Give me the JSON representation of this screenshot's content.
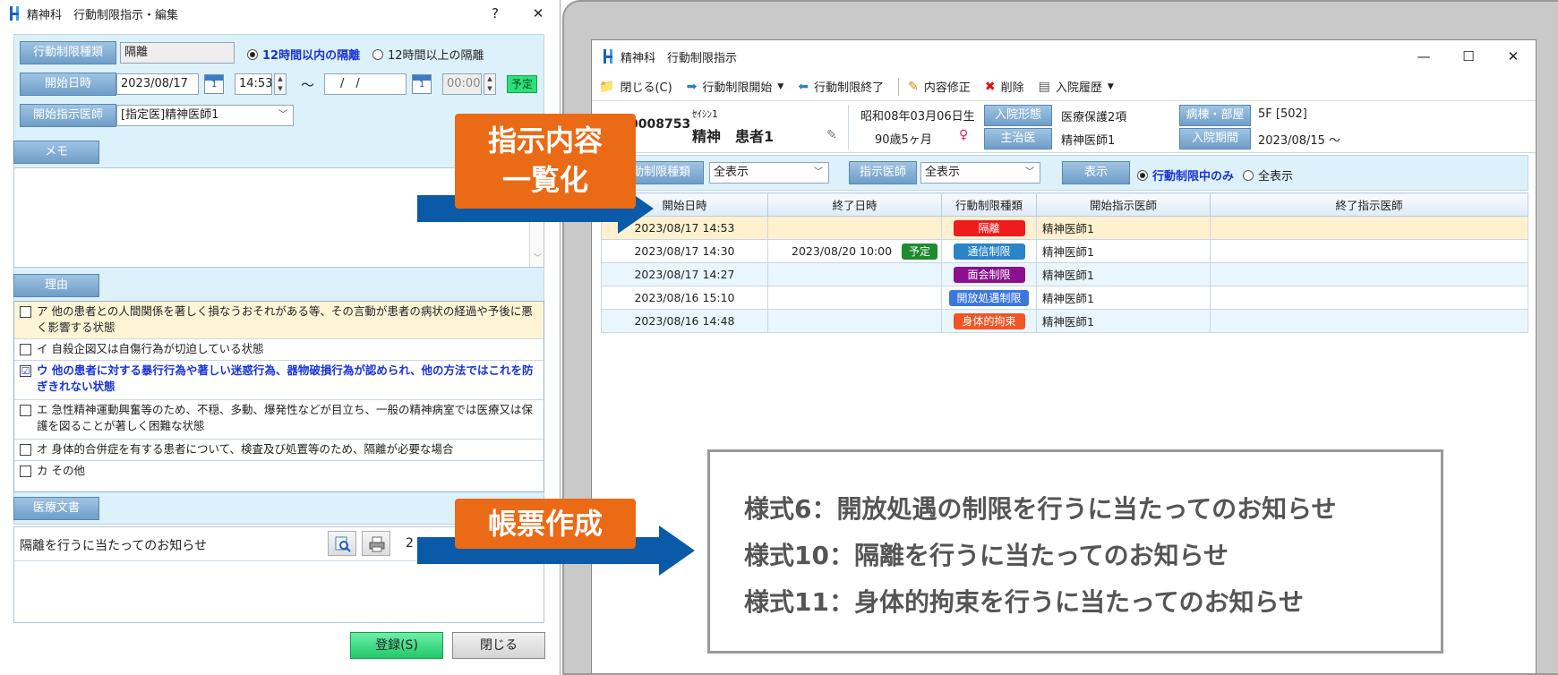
{
  "left_dialog": {
    "title": "精神科　行動制限指示・編集",
    "help": "?",
    "close": "✕",
    "type_label": "行動制限種類",
    "type_value": "隔離",
    "radio_12_within": "12時間以内の隔離",
    "radio_12_over": "12時間以上の隔離",
    "start_label": "開始日時",
    "start_date": "2023/08/17",
    "start_time": "14:53",
    "tilde": "～",
    "end_date": "　/　/",
    "end_time": "00:00",
    "yotei": "予定",
    "doctor_label": "開始指示医師",
    "doctor_value": "[指定医]精神医師1",
    "memo_label": "メモ",
    "reason_label": "理由",
    "reasons": [
      "ア 他の患者との人間関係を著しく損なうおそれがある等、その言動が患者の病状の経過や予後に悪く影響する状態",
      "イ 自殺企図又は自傷行為が切迫している状態",
      "ウ 他の患者に対する暴行行為や著しい迷惑行為、器物破損行為が認められ、他の方法ではこれを防ぎきれない状態",
      "エ 急性精神運動興奮等のため、不穏、多動、爆発性などが目立ち、一般の精神病室では医療又は保護を図ることが著しく困難な状態",
      "オ 身体的合併症を有する患者について、検査及び処置等のため、隔離が必要な場合",
      "カ その他"
    ],
    "reason_checked": "☑",
    "medical_doc_label": "医療文書",
    "doc_name": "隔離を行うに当たってのお知らせ",
    "doc_count": "2",
    "register_button": "登録(S)",
    "close_button": "閉じる"
  },
  "right_window": {
    "title": "精神科　行動制限指示",
    "minimize": "—",
    "maximize": "☐",
    "close": "✕",
    "toolbar": {
      "close": "閉じる(C)",
      "start": "行動制限開始",
      "end": "行動制限終了",
      "edit": "内容修正",
      "delete": "削除",
      "history": "入院履歴"
    },
    "patient": {
      "id": "0008753",
      "kana": "ｾｲｼﾝ1",
      "name": "精神　患者1",
      "dob": "昭和08年03月06日生",
      "age": "90歳5ヶ月",
      "admission_type_label": "入院形態",
      "admission_type": "医療保護2項",
      "attending_label": "主治医",
      "attending": "精神医師1",
      "ward_label": "病棟・部屋",
      "ward": "5F [502]",
      "period_label": "入院期間",
      "period": "2023/08/15 ～"
    },
    "filter": {
      "type_label": "行動制限種類",
      "type_value": "全表示",
      "doctor_label": "指示医師",
      "doctor_value": "全表示",
      "show_label": "表示",
      "radio_active": "行動制限中のみ",
      "radio_all": "全表示"
    },
    "columns": [
      "開始日時",
      "終了日時",
      "行動制限種類",
      "開始指示医師",
      "終了指示医師"
    ],
    "rows": [
      {
        "start": "2023/08/17 14:53",
        "end": "",
        "yotei": "",
        "type": "隔離",
        "color": "#ee1c1c",
        "doctor": "精神医師1"
      },
      {
        "start": "2023/08/17 14:30",
        "end": "2023/08/20 10:00",
        "yotei": "予定",
        "type": "通信制限",
        "color": "#2a84c8",
        "doctor": "精神医師1"
      },
      {
        "start": "2023/08/17 14:27",
        "end": "",
        "yotei": "",
        "type": "面会制限",
        "color": "#8b0f8e",
        "doctor": "精神医師1"
      },
      {
        "start": "2023/08/16 15:10",
        "end": "",
        "yotei": "",
        "type": "開放処遇制限",
        "color": "#3b78dd",
        "doctor": "精神医師1"
      },
      {
        "start": "2023/08/16 14:48",
        "end": "",
        "yotei": "",
        "type": "身体的拘束",
        "color": "#f15525",
        "doctor": "精神医師1"
      }
    ]
  },
  "overlay": {
    "callout1_line1": "指示内容",
    "callout1_line2": "一覧化",
    "callout2": "帳票作成",
    "forms": [
      "様式6：開放処遇の制限を行うに当たってのお知らせ",
      "様式10：隔離を行うに当たってのお知らせ",
      "様式11：身体的拘束を行うに当たってのお知らせ"
    ]
  }
}
